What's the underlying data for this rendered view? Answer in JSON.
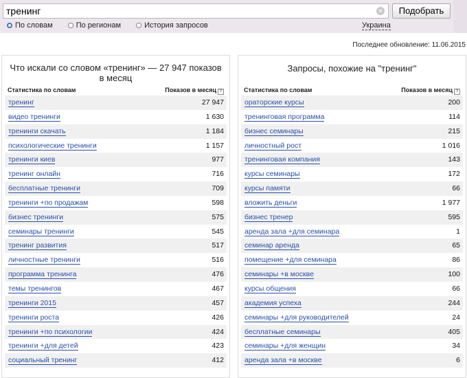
{
  "search": {
    "value": "тренинг",
    "button": "Подобрать"
  },
  "modes": [
    "По словам",
    "По регионам",
    "История запросов"
  ],
  "region": "Украина",
  "updated": "Последнее обновление: 11.06.2015",
  "left": {
    "title": "Что искали со словом «тренинг» — 27 947 показов в месяц",
    "col1": "Статистика по словам",
    "col2": "Показов в месяц",
    "rows": [
      {
        "q": "тренинг",
        "n": "27 947"
      },
      {
        "q": "видео тренинги",
        "n": "1 630"
      },
      {
        "q": "тренинги скачать",
        "n": "1 184"
      },
      {
        "q": "психологические тренинги",
        "n": "1 157"
      },
      {
        "q": "тренинги киев",
        "n": "977"
      },
      {
        "q": "тренинг онлайн",
        "n": "716"
      },
      {
        "q": "бесплатные тренинги",
        "n": "709"
      },
      {
        "q": "тренинги +по продажам",
        "n": "598"
      },
      {
        "q": "бизнес тренинги",
        "n": "575"
      },
      {
        "q": "семинары тренинги",
        "n": "545"
      },
      {
        "q": "тренинг развития",
        "n": "517"
      },
      {
        "q": "личностные тренинги",
        "n": "516"
      },
      {
        "q": "программа тренинга",
        "n": "476"
      },
      {
        "q": "темы тренингов",
        "n": "467"
      },
      {
        "q": "тренинги 2015",
        "n": "457"
      },
      {
        "q": "тренинги роста",
        "n": "426"
      },
      {
        "q": "тренинги +по психологии",
        "n": "424"
      },
      {
        "q": "тренинги +для детей",
        "n": "423"
      },
      {
        "q": "социальный тренинг",
        "n": "412"
      }
    ]
  },
  "right": {
    "title": "Запросы, похожие на \"тренинг\"",
    "col1": "Статистика по словам",
    "col2": "Показов в месяц",
    "rows": [
      {
        "q": "ораторские курсы",
        "n": "200"
      },
      {
        "q": "тренинговая программа",
        "n": "114"
      },
      {
        "q": "бизнес семинары",
        "n": "215"
      },
      {
        "q": "личностный рост",
        "n": "1 016"
      },
      {
        "q": "тренинговая компания",
        "n": "143"
      },
      {
        "q": "курсы семинары",
        "n": "172"
      },
      {
        "q": "курсы памяти",
        "n": "66"
      },
      {
        "q": "вложить деньги",
        "n": "1 977"
      },
      {
        "q": "бизнес тренер",
        "n": "595"
      },
      {
        "q": "аренда зала +для семинара",
        "n": "1"
      },
      {
        "q": "семинар аренда",
        "n": "65"
      },
      {
        "q": "помещение +для семинара",
        "n": "86"
      },
      {
        "q": "семинары +в москве",
        "n": "100"
      },
      {
        "q": "курсы общения",
        "n": "66"
      },
      {
        "q": "академия успеха",
        "n": "244"
      },
      {
        "q": "семинары +для руководителей",
        "n": "24"
      },
      {
        "q": "бесплатные семинары",
        "n": "405"
      },
      {
        "q": "семинары +для женщин",
        "n": "34"
      },
      {
        "q": "аренда зала +в москве",
        "n": "6"
      }
    ]
  }
}
